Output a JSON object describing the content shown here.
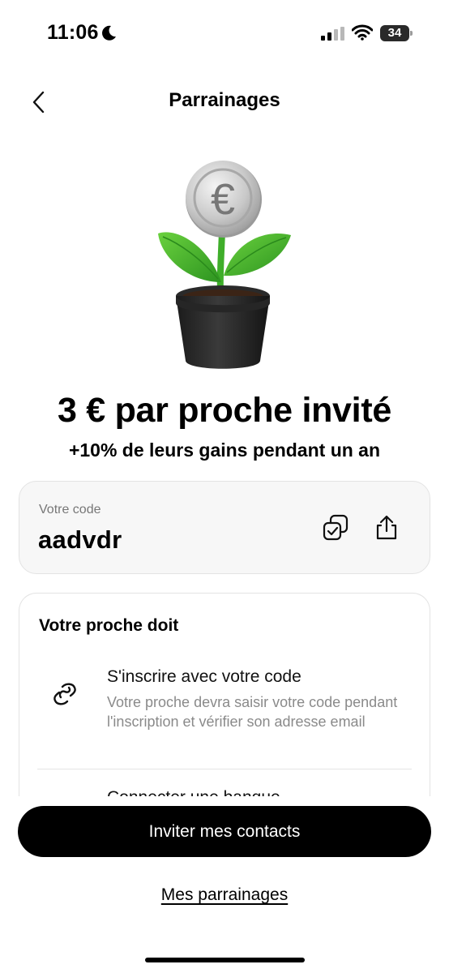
{
  "status_bar": {
    "time": "11:06",
    "battery": "34",
    "icons": [
      "moon-icon",
      "signal-icon",
      "wifi-icon",
      "battery-icon"
    ]
  },
  "header": {
    "title": "Parrainages",
    "back_icon": "chevron-left-icon"
  },
  "hero": {
    "illustration": "coin-plant-icon",
    "headline": "3 € par proche invité",
    "subline": "+10% de leurs gains pendant un an"
  },
  "code_card": {
    "label": "Votre code",
    "code": "aadvdr",
    "copy_icon": "copy-icon",
    "share_icon": "share-icon"
  },
  "steps": {
    "title": "Votre proche doit",
    "items": [
      {
        "icon": "link-icon",
        "title": "S'inscrire avec votre code",
        "description": "Votre proche devra saisir votre code pendant l'inscription et vérifier son adresse email"
      },
      {
        "title": "Connecter une banque"
      }
    ]
  },
  "actions": {
    "primary": "Inviter mes contacts",
    "secondary": "Mes parrainages"
  },
  "colors": {
    "primary_button": "#000000",
    "card_background": "#f7f7f7",
    "muted_text": "#8a8a8a",
    "leaf_green": "#3fae2a"
  }
}
